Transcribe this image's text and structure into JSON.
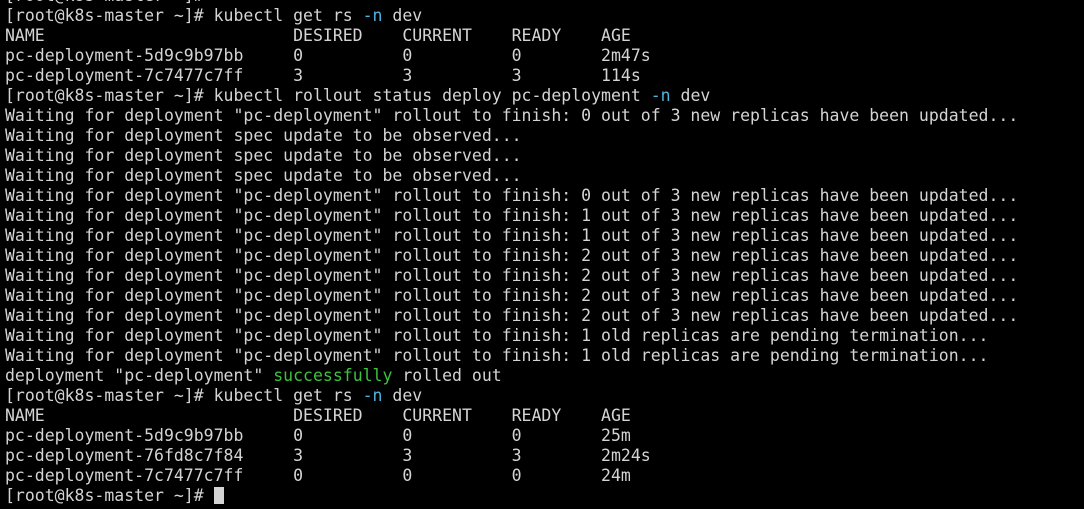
{
  "colors": {
    "background": "#000000",
    "foreground": "#d4d4d4",
    "flag": "#4fb3e0",
    "success": "#3cc23c"
  },
  "cursor": "block",
  "lines": [
    {
      "id": "partial-line",
      "segments": [
        {
          "t": "[root@k8s-master ~]#"
        }
      ]
    },
    {
      "id": "cmd-get-rs-1",
      "segments": [
        {
          "t": "[root@k8s-master ~]# kubectl get rs "
        },
        {
          "t": "-n",
          "c": "flag"
        },
        {
          "t": " dev"
        }
      ]
    },
    {
      "id": "rs-header-1",
      "segments": [
        {
          "t": "NAME                         DESIRED    CURRENT    READY    AGE"
        }
      ]
    },
    {
      "id": "rs-row-1",
      "segments": [
        {
          "t": "pc-deployment-5d9c9b97bb     0          0          0        2m47s"
        }
      ]
    },
    {
      "id": "rs-row-2",
      "segments": [
        {
          "t": "pc-deployment-7c7477c7ff     3          3          3        114s"
        }
      ]
    },
    {
      "id": "cmd-rollout-status",
      "segments": [
        {
          "t": "[root@k8s-master ~]# kubectl rollout status deploy pc-deployment "
        },
        {
          "t": "-n",
          "c": "flag"
        },
        {
          "t": " dev"
        }
      ]
    },
    {
      "id": "out-1",
      "segments": [
        {
          "t": "Waiting for deployment \"pc-deployment\" rollout to finish: 0 out of 3 new replicas have been updated..."
        }
      ]
    },
    {
      "id": "out-2",
      "segments": [
        {
          "t": "Waiting for deployment spec update to be observed..."
        }
      ]
    },
    {
      "id": "out-3",
      "segments": [
        {
          "t": "Waiting for deployment spec update to be observed..."
        }
      ]
    },
    {
      "id": "out-4",
      "segments": [
        {
          "t": "Waiting for deployment spec update to be observed..."
        }
      ]
    },
    {
      "id": "out-5",
      "segments": [
        {
          "t": "Waiting for deployment \"pc-deployment\" rollout to finish: 0 out of 3 new replicas have been updated..."
        }
      ]
    },
    {
      "id": "out-6",
      "segments": [
        {
          "t": "Waiting for deployment \"pc-deployment\" rollout to finish: 1 out of 3 new replicas have been updated..."
        }
      ]
    },
    {
      "id": "out-7",
      "segments": [
        {
          "t": "Waiting for deployment \"pc-deployment\" rollout to finish: 1 out of 3 new replicas have been updated..."
        }
      ]
    },
    {
      "id": "out-8",
      "segments": [
        {
          "t": "Waiting for deployment \"pc-deployment\" rollout to finish: 2 out of 3 new replicas have been updated..."
        }
      ]
    },
    {
      "id": "out-9",
      "segments": [
        {
          "t": "Waiting for deployment \"pc-deployment\" rollout to finish: 2 out of 3 new replicas have been updated..."
        }
      ]
    },
    {
      "id": "out-10",
      "segments": [
        {
          "t": "Waiting for deployment \"pc-deployment\" rollout to finish: 2 out of 3 new replicas have been updated..."
        }
      ]
    },
    {
      "id": "out-11",
      "segments": [
        {
          "t": "Waiting for deployment \"pc-deployment\" rollout to finish: 2 out of 3 new replicas have been updated..."
        }
      ]
    },
    {
      "id": "out-12",
      "segments": [
        {
          "t": "Waiting for deployment \"pc-deployment\" rollout to finish: 1 old replicas are pending termination..."
        }
      ]
    },
    {
      "id": "out-13",
      "segments": [
        {
          "t": "Waiting for deployment \"pc-deployment\" rollout to finish: 1 old replicas are pending termination..."
        }
      ]
    },
    {
      "id": "out-success",
      "segments": [
        {
          "t": "deployment \"pc-deployment\" "
        },
        {
          "t": "successfully",
          "c": "ok"
        },
        {
          "t": " rolled out"
        }
      ]
    },
    {
      "id": "cmd-get-rs-2",
      "segments": [
        {
          "t": "[root@k8s-master ~]# kubectl get rs "
        },
        {
          "t": "-n",
          "c": "flag"
        },
        {
          "t": " dev"
        }
      ]
    },
    {
      "id": "rs-header-2",
      "segments": [
        {
          "t": "NAME                         DESIRED    CURRENT    READY    AGE"
        }
      ]
    },
    {
      "id": "rs-row-3",
      "segments": [
        {
          "t": "pc-deployment-5d9c9b97bb     0          0          0        25m"
        }
      ]
    },
    {
      "id": "rs-row-4",
      "segments": [
        {
          "t": "pc-deployment-76fd8c7f84     3          3          3        2m24s"
        }
      ]
    },
    {
      "id": "rs-row-5",
      "segments": [
        {
          "t": "pc-deployment-7c7477c7ff     0          0          0        24m"
        }
      ]
    },
    {
      "id": "prompt-final",
      "segments": [
        {
          "t": "[root@k8s-master ~]# "
        }
      ],
      "cursor": true
    }
  ]
}
